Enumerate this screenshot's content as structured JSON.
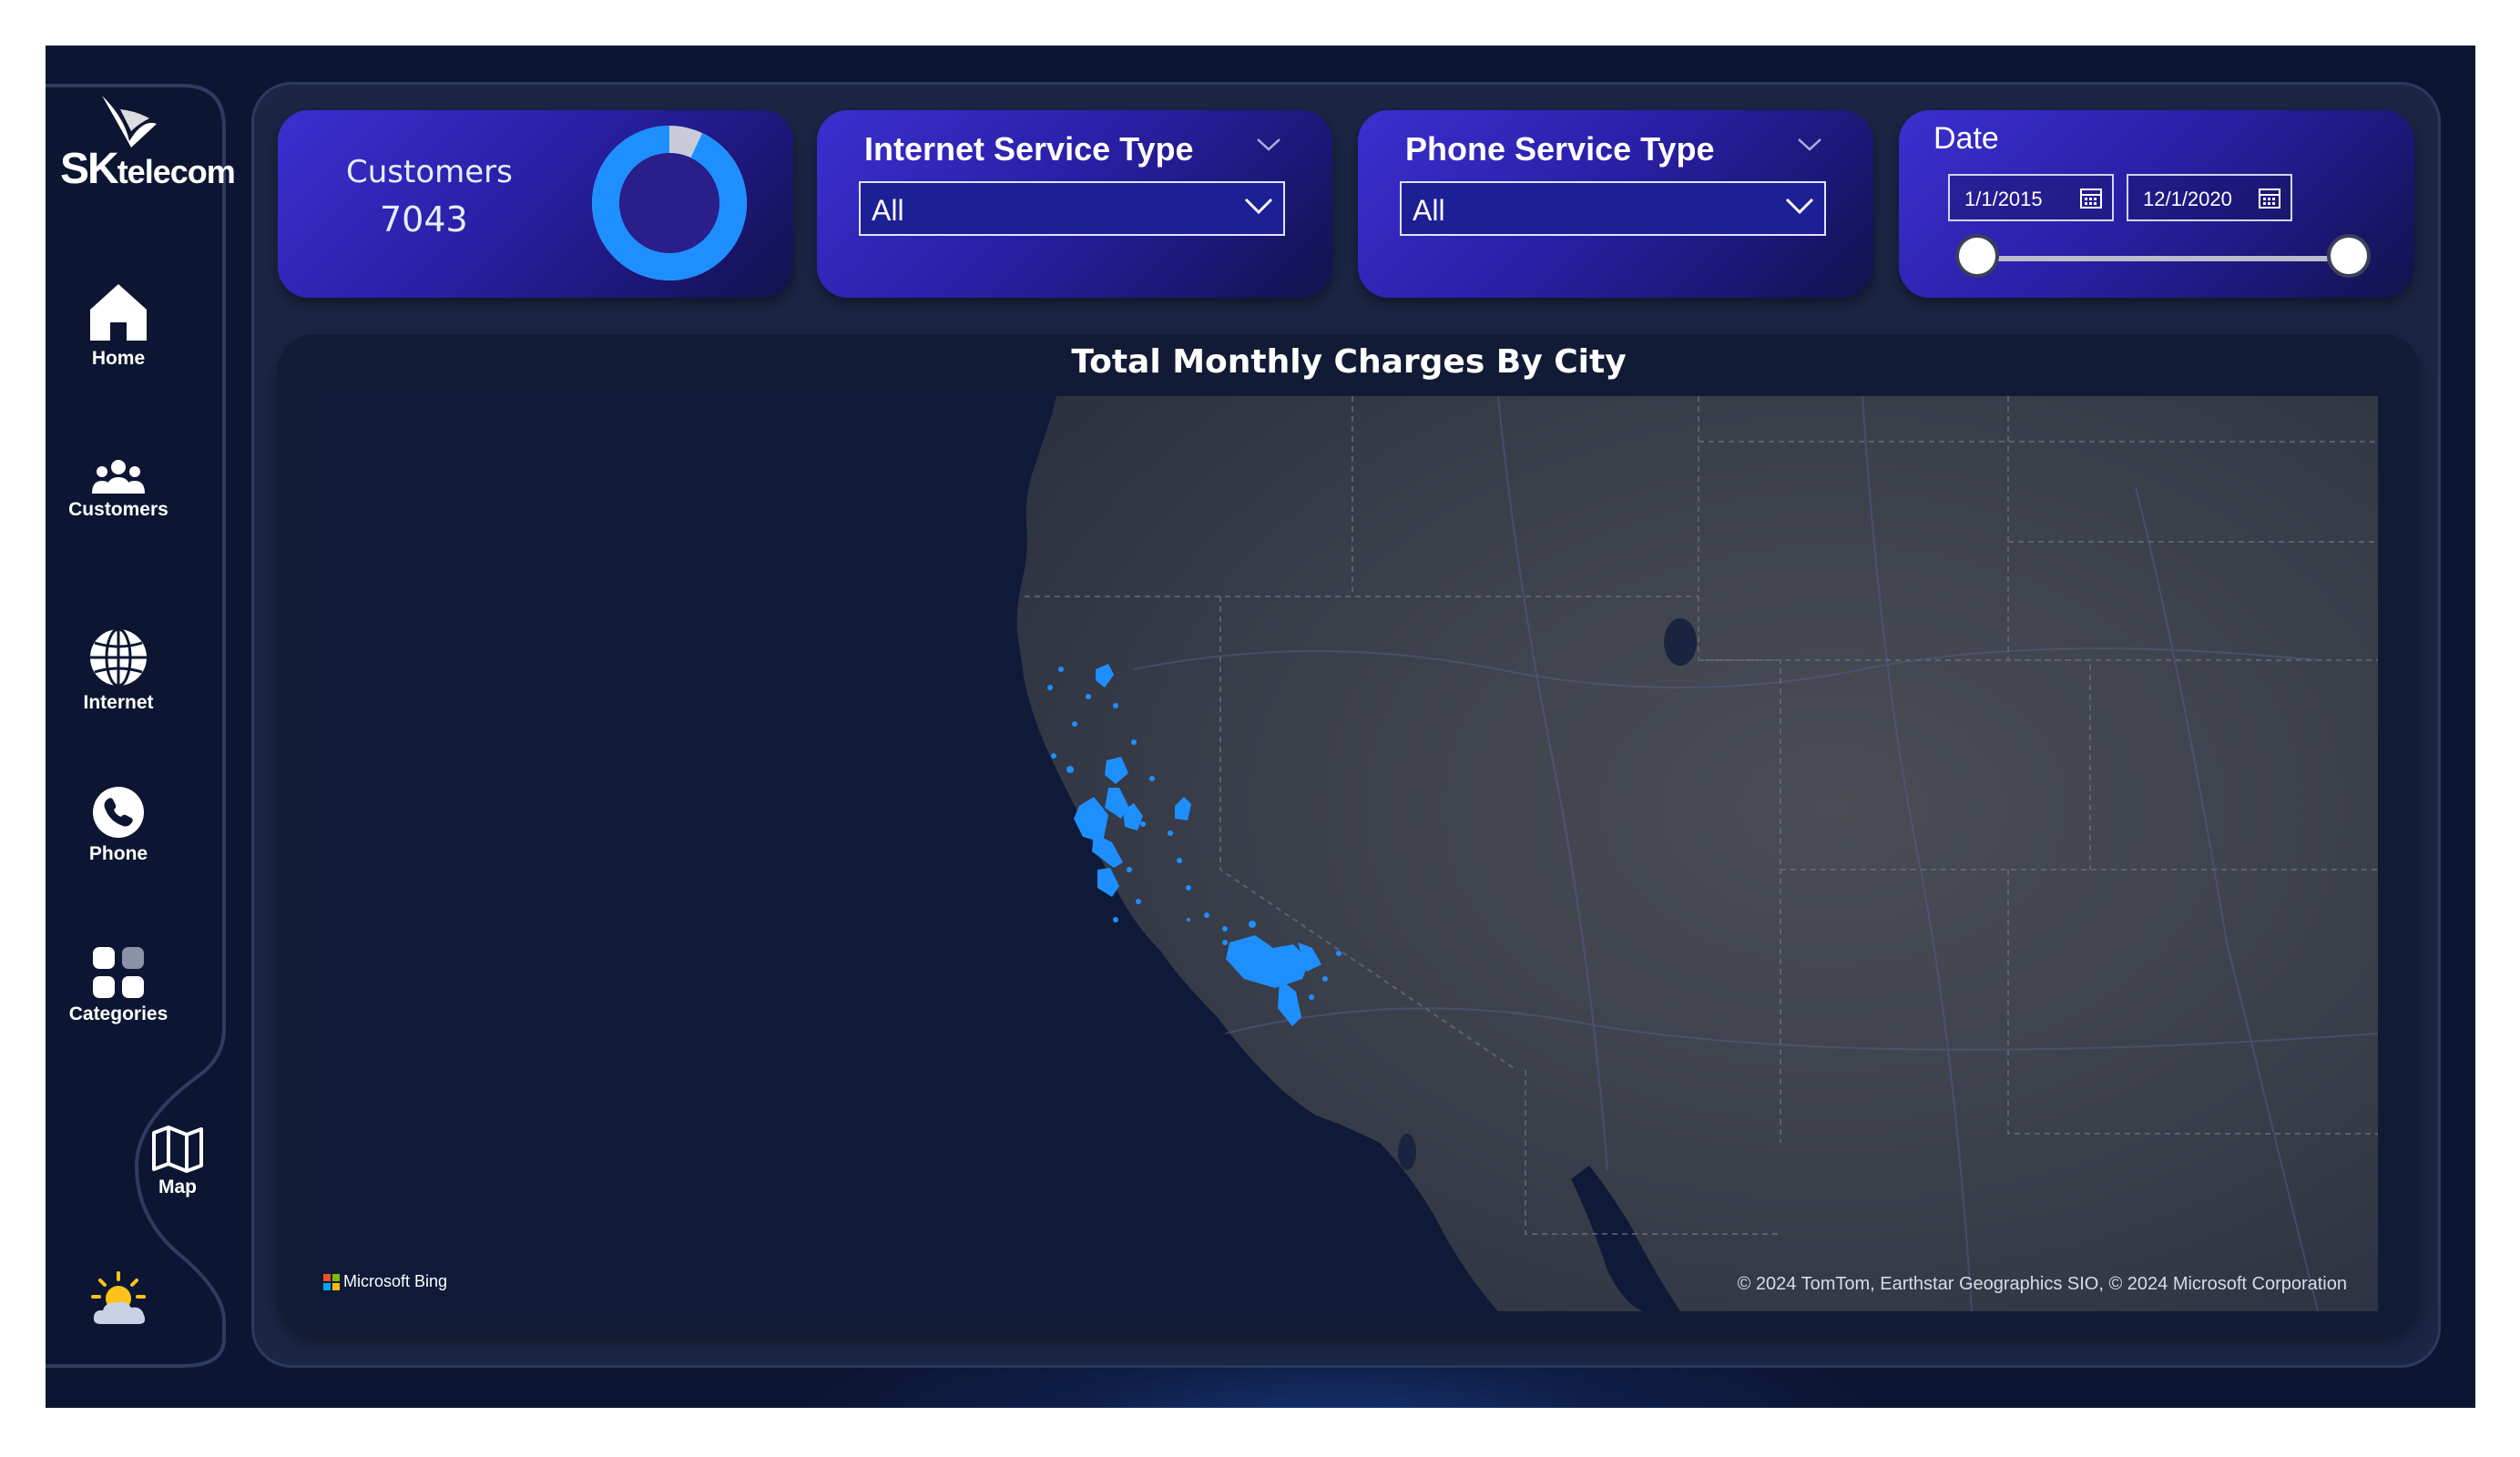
{
  "brand": {
    "prefix": "SK",
    "suffix": "telecom"
  },
  "sidebar": {
    "items": [
      {
        "label": "Home",
        "icon": "home-icon"
      },
      {
        "label": "Customers",
        "icon": "users-icon"
      },
      {
        "label": "Internet",
        "icon": "globe-icon"
      },
      {
        "label": "Phone",
        "icon": "phone-icon"
      },
      {
        "label": "Categories",
        "icon": "grid-icon"
      },
      {
        "label": "Map",
        "icon": "map-icon",
        "active": true
      }
    ],
    "weather_icon": "weather-sun-cloud-icon"
  },
  "kpi": {
    "label": "Customers",
    "value": "7043",
    "donut_fraction": 0.93
  },
  "internet_slicer": {
    "title": "Internet Service Type",
    "selected": "All"
  },
  "phone_slicer": {
    "title": "Phone Service Type",
    "selected": "All"
  },
  "date_slicer": {
    "title": "Date",
    "start": "1/1/2015",
    "end": "12/1/2020"
  },
  "map": {
    "title": "Total Monthly Charges By City",
    "attribution": "Microsoft Bing",
    "copyright": "© 2024 TomTom, Earthstar Geographics SIO, © 2024 Microsoft Corporation"
  },
  "colors": {
    "background": "#0c1632",
    "card_gradient_start": "#3b2fd0",
    "card_gradient_end": "#12124a",
    "accent_blue": "#1e8fff",
    "map_ocean": "#0e1a38",
    "map_land": "#3a3f4c"
  }
}
